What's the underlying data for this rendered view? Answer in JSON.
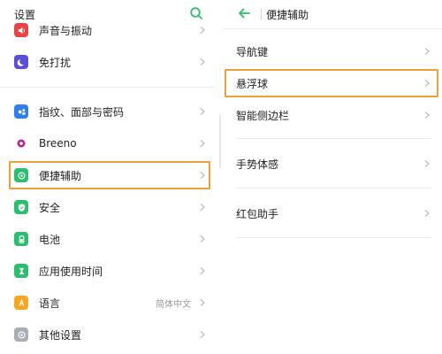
{
  "colors": {
    "accent": "#2dbd6e",
    "highlight": "#f0a03a",
    "icon_red": "#e64545",
    "icon_purple": "#5a4fd6",
    "icon_blue": "#2f7fe6",
    "icon_magenta": "#b3268f",
    "icon_green": "#2dbd6e",
    "icon_orange": "#f5a623",
    "icon_gray": "#a9adb5"
  },
  "left": {
    "title": "设置",
    "search_icon": "search-icon",
    "items": [
      {
        "label": "声音与振动",
        "icon": "speaker-icon"
      },
      {
        "label": "免打扰",
        "icon": "moon-icon"
      },
      {
        "label": "指纹、面部与密码",
        "icon": "face-icon"
      },
      {
        "label": "Breeno",
        "icon": "breeno-icon"
      },
      {
        "label": "便捷辅助",
        "icon": "assist-icon"
      },
      {
        "label": "安全",
        "icon": "shield-icon"
      },
      {
        "label": "电池",
        "icon": "battery-icon"
      },
      {
        "label": "应用使用时间",
        "icon": "hourglass-icon"
      },
      {
        "label": "语言",
        "icon": "language-icon",
        "value": "简体中文"
      },
      {
        "label": "其他设置",
        "icon": "more-settings-icon"
      }
    ]
  },
  "right": {
    "title": "便捷辅助",
    "items": [
      {
        "label": "导航键"
      },
      {
        "label": "悬浮球"
      },
      {
        "label": "智能侧边栏"
      },
      {
        "label": "手势体感"
      },
      {
        "label": "红包助手"
      }
    ]
  }
}
